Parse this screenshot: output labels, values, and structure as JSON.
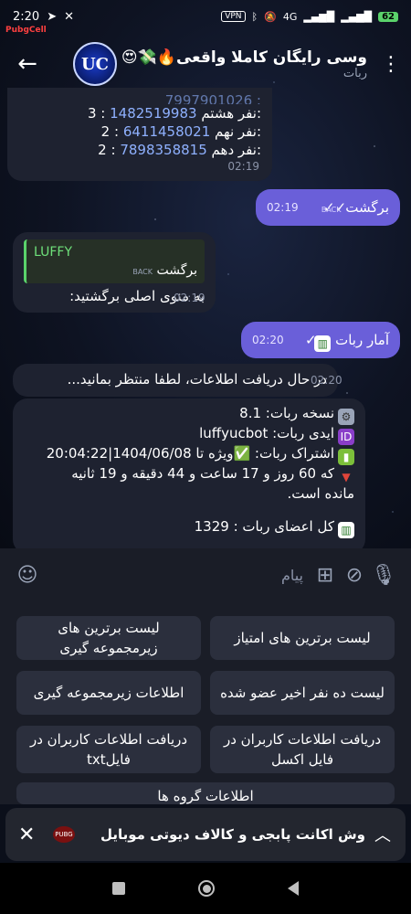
{
  "status_bar": {
    "time": "2:20",
    "vpn": "VPN",
    "network": "4G",
    "battery": "62"
  },
  "status_logo": "PubgCell",
  "header": {
    "title": "وسی رایگان کاملا واقعی🔥💸😍",
    "subtitle": "ربات",
    "avatar_text": "UC"
  },
  "msg1": {
    "top_partial": "7997901026 :",
    "lines": [
      {
        "label": "نفر هشتم:",
        "id": "1482519983",
        "count": "3 :"
      },
      {
        "label": "نفر نهم:",
        "id": "6411458021",
        "count": "2 :"
      },
      {
        "label": "نفر دهم:",
        "id": "7898358815",
        "count": "2 :"
      }
    ],
    "time": "02:19"
  },
  "msg2": {
    "text": "برگشت",
    "badge": "BACK",
    "time": "02:19"
  },
  "msg3": {
    "quote_title": "LUFFY",
    "quote_text": "برگشت",
    "badge": "BACK",
    "text": "به منوی اصلی برگشتید:",
    "time": "02:19"
  },
  "msg4": {
    "text": "آمار ربات",
    "time": "02:20"
  },
  "msg5": {
    "text": "در حال دریافت اطلاعات، لطفا منتظر بمانید...",
    "time": "02:20"
  },
  "msg6": {
    "version": "نسخه ربات: 8.1",
    "bot_id": "ایدی ربات: luffyucbot",
    "subscription": "اشتراک ربات: ✅ویژه تا 1404/06/08|20:04:22",
    "remaining_1": "که 60 روز و 17 ساعت و 44 دقیقه و 19 ثانیه",
    "remaining_2": "مانده است.",
    "members": "کل اعضای ربات : 1329"
  },
  "input": {
    "placeholder": "پیام"
  },
  "keyboard": {
    "b1": "لیست برترین های امتیاز",
    "b2": "لیست برترین های زیرمجموعه گیری",
    "b3": "لیست ده نفر اخیر عضو شده",
    "b4": "اطلاعات زیرمجموعه گیری",
    "b5": "دریافت اطلاعات کاربران در فایل اکسل",
    "b6": "دریافت اطلاعات کاربران در فایلtxt",
    "b7": "اطلاعات گروه ها"
  },
  "banner": {
    "text": "وش اکانت پابجی و کالاف دیوتی موبایل",
    "logo": "PUBG"
  }
}
